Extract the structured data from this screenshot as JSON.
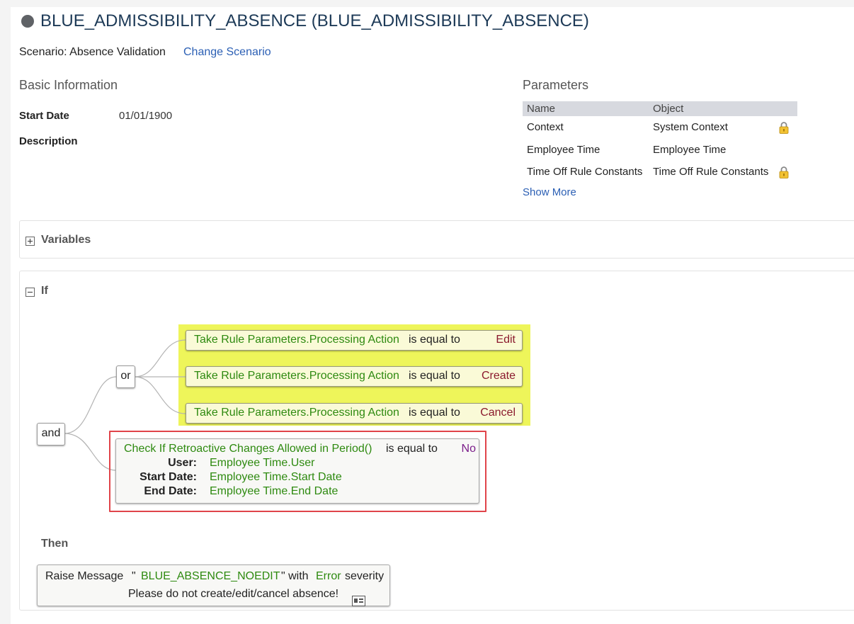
{
  "header": {
    "title": "BLUE_ADMISSIBILITY_ABSENCE (BLUE_ADMISSIBILITY_ABSENCE)",
    "scenario_label": "Scenario: Absence Validation",
    "change_scenario": "Change Scenario"
  },
  "basic_info": {
    "title": "Basic Information",
    "start_date_label": "Start Date",
    "start_date_value": "01/01/1900",
    "description_label": "Description"
  },
  "parameters": {
    "title": "Parameters",
    "col_name": "Name",
    "col_object": "Object",
    "rows": [
      {
        "name": "Context",
        "object": "System Context",
        "locked": true
      },
      {
        "name": "Employee Time",
        "object": "Employee Time",
        "locked": false
      },
      {
        "name": "Time Off Rule Constants",
        "object": "Time Off Rule Constants",
        "locked": true
      }
    ],
    "show_more": "Show More"
  },
  "variables": {
    "title": "Variables",
    "toggle": "expand"
  },
  "if_section": {
    "title": "If",
    "toggle": "collapse",
    "and_label": "and",
    "or_label": "or",
    "or_conditions": [
      {
        "expr": "Take Rule Parameters.Processing Action",
        "op": "is equal to",
        "value": "Edit"
      },
      {
        "expr": "Take Rule Parameters.Processing Action",
        "op": "is equal to",
        "value": "Create"
      },
      {
        "expr": "Take Rule Parameters.Processing Action",
        "op": "is equal to",
        "value": "Cancel"
      }
    ],
    "check": {
      "expr": "Check If Retroactive Changes Allowed in Period()",
      "op": "is equal to",
      "value": "No",
      "params": [
        {
          "label": "User:",
          "value": "Employee Time.User"
        },
        {
          "label": "Start Date:",
          "value": "Employee Time.Start Date"
        },
        {
          "label": "End Date:",
          "value": "Employee Time.End Date"
        }
      ]
    }
  },
  "then_section": {
    "title": "Then",
    "raise_message": "Raise Message",
    "open_quote": "\"",
    "message_key": "BLUE_ABSENCE_NOEDIT",
    "close_quote_with": "\" with",
    "severity": "Error",
    "severity_word": "severity",
    "message_text": "Please do not create/edit/cancel absence!"
  },
  "colors": {
    "highlight": "#eef55a",
    "expression_green": "#2e8a10",
    "value_red": "#8b1a2e",
    "value_purple": "#7b1e8a",
    "link_blue": "#2b5fb4",
    "frame_red": "#e0444a"
  }
}
